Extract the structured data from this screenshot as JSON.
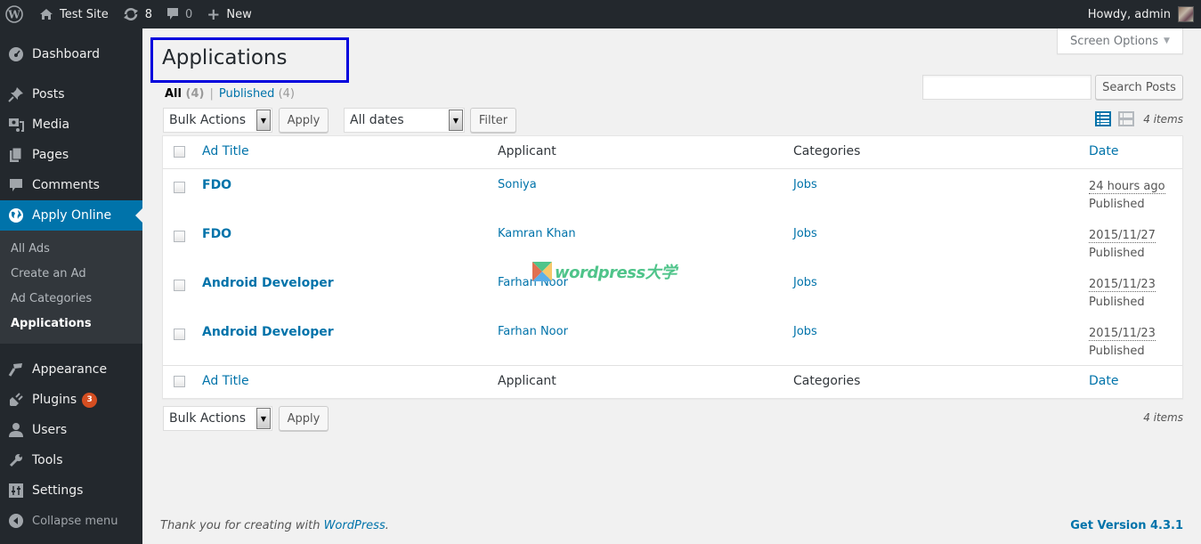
{
  "adminbar": {
    "site_name": "Test Site",
    "updates_count": "8",
    "comments_count": "0",
    "new_label": "New",
    "greeting": "Howdy, admin"
  },
  "sidebar": {
    "items": [
      {
        "label": "Dashboard",
        "icon": "dashboard-icon"
      },
      {
        "label": "Posts",
        "icon": "pin-icon"
      },
      {
        "label": "Media",
        "icon": "media-icon"
      },
      {
        "label": "Pages",
        "icon": "pages-icon"
      },
      {
        "label": "Comments",
        "icon": "comment-icon"
      },
      {
        "label": "Apply Online",
        "icon": "globe-icon"
      }
    ],
    "submenu": [
      "All Ads",
      "Create an Ad",
      "Ad Categories",
      "Applications"
    ],
    "items_after": [
      {
        "label": "Appearance",
        "icon": "paintbrush-icon"
      },
      {
        "label": "Plugins",
        "icon": "plugin-icon",
        "badge": "3"
      },
      {
        "label": "Users",
        "icon": "user-icon"
      },
      {
        "label": "Tools",
        "icon": "wrench-icon"
      },
      {
        "label": "Settings",
        "icon": "settings-icon"
      }
    ],
    "collapse_label": "Collapse menu"
  },
  "main": {
    "screen_options": "Screen Options",
    "title": "Applications",
    "views": {
      "all_label": "All",
      "all_count": "(4)",
      "published_label": "Published",
      "published_count": "(4)",
      "separator": "|"
    },
    "search": {
      "value": "",
      "button": "Search Posts"
    },
    "bulk_actions": "Bulk Actions",
    "apply": "Apply",
    "date_filter": "All dates",
    "filter": "Filter",
    "items_count": "4 items",
    "columns": {
      "title": "Ad Title",
      "applicant": "Applicant",
      "categories": "Categories",
      "date": "Date"
    },
    "rows": [
      {
        "title": "FDO",
        "applicant": "Soniya",
        "category": "Jobs",
        "date": "24 hours ago",
        "status": "Published"
      },
      {
        "title": "FDO",
        "applicant": "Kamran Khan",
        "category": "Jobs",
        "date": "2015/11/27",
        "status": "Published"
      },
      {
        "title": "Android Developer",
        "applicant": "Farhan Noor",
        "category": "Jobs",
        "date": "2015/11/23",
        "status": "Published"
      },
      {
        "title": "Android Developer",
        "applicant": "Farhan Noor",
        "category": "Jobs",
        "date": "2015/11/23",
        "status": "Published"
      }
    ],
    "watermark": "wordpress大学"
  },
  "footer": {
    "thanks_prefix": "Thank you for creating with ",
    "thanks_link": "WordPress",
    "thanks_suffix": ".",
    "version": "Get Version 4.3.1"
  },
  "colors": {
    "accent": "#0073aa",
    "adminbar": "#23282d",
    "badge": "#d54e21",
    "highlight_box": "#0000dd"
  }
}
